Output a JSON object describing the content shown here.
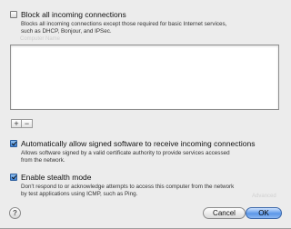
{
  "block_all": {
    "title": "Block all incoming connections",
    "description_line1": "Blocks all incoming connections except those required for basic Internet services,",
    "description_line2": "such as DHCP, Bonjour, and IPSec.",
    "checked": false
  },
  "app_list": {
    "header_ghost": "Computer Name"
  },
  "list_buttons": {
    "add": "+",
    "remove": "−"
  },
  "signed_software": {
    "title": "Automatically allow signed software to receive incoming connections",
    "description_line1": "Allows software signed by a valid certificate authority to provide services accessed",
    "description_line2": "from the network.",
    "checked": true
  },
  "stealth_mode": {
    "title": "Enable stealth mode",
    "description_line1": "Don't respond to or acknowledge attempts to access this computer from the network",
    "description_line2": "by test applications using ICMP, such as Ping.",
    "checked": true
  },
  "background_text": "Advanced",
  "footer": {
    "help": "?",
    "cancel": "Cancel",
    "ok": "OK"
  }
}
